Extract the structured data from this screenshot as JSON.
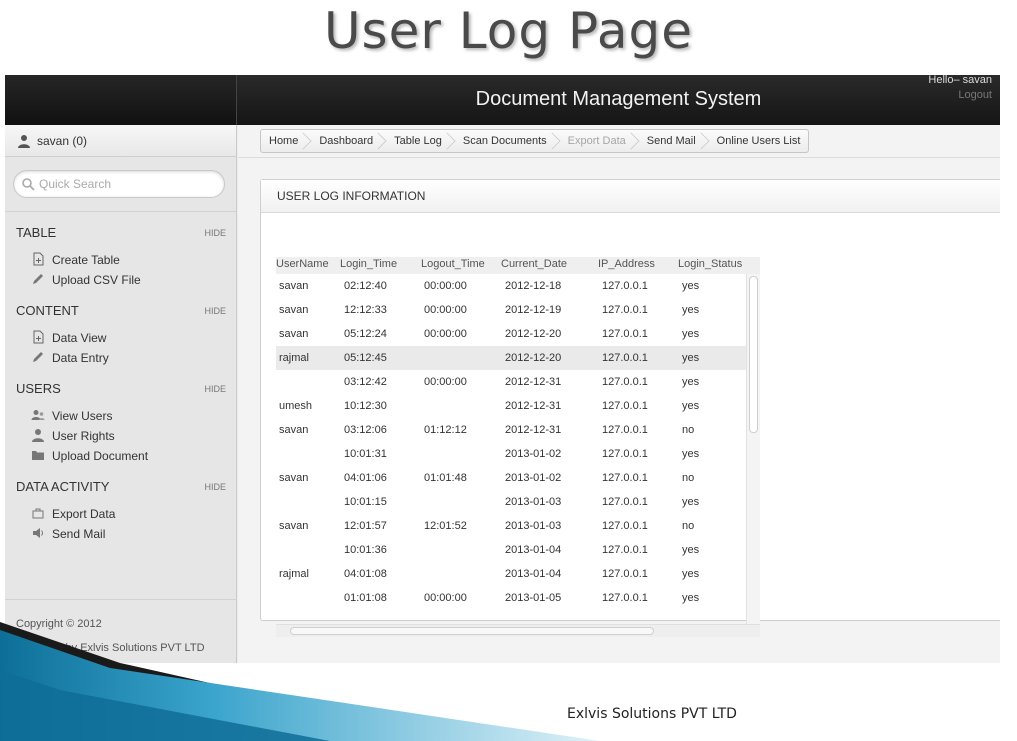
{
  "slide": {
    "title": "User Log Page",
    "footer": "Exlvis Solutions PVT LTD"
  },
  "header": {
    "app_title": "Document Management System",
    "greeting": "Hello– savan",
    "logout_label": "Logout"
  },
  "sidebar": {
    "user_label": "savan (0)",
    "search_placeholder": "Quick Search",
    "sections": [
      {
        "title": "TABLE",
        "hide": "HIDE",
        "items": [
          {
            "label": "Create Table",
            "icon": "document-add-icon"
          },
          {
            "label": "Upload CSV File",
            "icon": "pencil-icon"
          }
        ]
      },
      {
        "title": "CONTENT",
        "hide": "HIDE",
        "items": [
          {
            "label": "Data View",
            "icon": "document-add-icon"
          },
          {
            "label": "Data Entry",
            "icon": "pencil-icon"
          }
        ]
      },
      {
        "title": "USERS",
        "hide": "HIDE",
        "items": [
          {
            "label": "View Users",
            "icon": "users-icon"
          },
          {
            "label": "User Rights",
            "icon": "user-icon"
          },
          {
            "label": "Upload Document",
            "icon": "folder-icon"
          }
        ]
      },
      {
        "title": "DATA ACTIVITY",
        "hide": "HIDE",
        "items": [
          {
            "label": "Export Data",
            "icon": "export-icon"
          },
          {
            "label": "Send Mail",
            "icon": "speaker-icon"
          }
        ]
      }
    ],
    "copyright": "Copyright © 2012",
    "designed_by": "Designed by Exlvis Solutions PVT LTD"
  },
  "breadcrumb": [
    {
      "label": "Home",
      "disabled": false
    },
    {
      "label": "Dashboard",
      "disabled": false
    },
    {
      "label": "Table Log",
      "disabled": false
    },
    {
      "label": "Scan Documents",
      "disabled": false
    },
    {
      "label": "Export Data",
      "disabled": true
    },
    {
      "label": "Send Mail",
      "disabled": false
    },
    {
      "label": "Online Users List",
      "disabled": false
    }
  ],
  "panel": {
    "title": "USER LOG INFORMATION",
    "columns": [
      "UserName",
      "Login_Time",
      "Logout_Time",
      "Current_Date",
      "IP_Address",
      "Login_Status"
    ],
    "rows": [
      [
        "savan",
        "02:12:40",
        "00:00:00",
        "2012-12-18",
        "127.0.0.1",
        "yes"
      ],
      [
        "savan",
        "12:12:33",
        "00:00:00",
        "2012-12-19",
        "127.0.0.1",
        "yes"
      ],
      [
        "savan",
        "05:12:24",
        "00:00:00",
        "2012-12-20",
        "127.0.0.1",
        "yes"
      ],
      [
        "rajmal",
        "05:12:45",
        "",
        "2012-12-20",
        "127.0.0.1",
        "yes"
      ],
      [
        "",
        "03:12:42",
        "00:00:00",
        "2012-12-31",
        "127.0.0.1",
        "yes"
      ],
      [
        "umesh",
        "10:12:30",
        "",
        "2012-12-31",
        "127.0.0.1",
        "yes"
      ],
      [
        "savan",
        "03:12:06",
        "01:12:12",
        "2012-12-31",
        "127.0.0.1",
        "no"
      ],
      [
        "",
        "10:01:31",
        "",
        "2013-01-02",
        "127.0.0.1",
        "yes"
      ],
      [
        "savan",
        "04:01:06",
        "01:01:48",
        "2013-01-02",
        "127.0.0.1",
        "no"
      ],
      [
        "",
        "10:01:15",
        "",
        "2013-01-03",
        "127.0.0.1",
        "yes"
      ],
      [
        "savan",
        "12:01:57",
        "12:01:52",
        "2013-01-03",
        "127.0.0.1",
        "no"
      ],
      [
        "",
        "10:01:36",
        "",
        "2013-01-04",
        "127.0.0.1",
        "yes"
      ],
      [
        "rajmal",
        "04:01:08",
        "",
        "2013-01-04",
        "127.0.0.1",
        "yes"
      ],
      [
        "",
        "01:01:08",
        "00:00:00",
        "2013-01-05",
        "127.0.0.1",
        "yes"
      ]
    ],
    "selected_row": 3
  },
  "colors": {
    "header_bg": "#1c1c1c",
    "sidebar_bg": "#e6e6e6",
    "content_bg": "#f3f3f3",
    "accent_blue": "#1b8bb4"
  }
}
